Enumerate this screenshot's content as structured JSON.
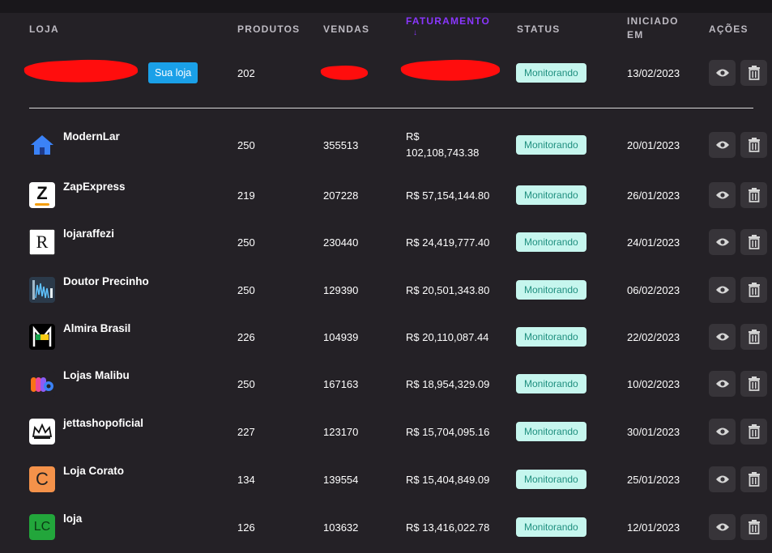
{
  "columns": {
    "loja": "LOJA",
    "produtos": "PRODUTOS",
    "vendas": "VENDAS",
    "faturamento": "FATURAMENTO",
    "sort_arrow": "↓",
    "status": "STATUS",
    "iniciado_l1": "INICIADO",
    "iniciado_l2": "EM",
    "acoes": "AÇÕES"
  },
  "own_store": {
    "badge": "Sua loja",
    "produtos": "202",
    "status": "Monitorando",
    "iniciado": "13/02/2023"
  },
  "stores": [
    {
      "name": "ModernLar",
      "produtos": "250",
      "vendas": "355513",
      "fat_l1": "R$",
      "fat_l2": "102,108,743.38",
      "status": "Monitorando",
      "iniciado": "20/01/2023",
      "logo": "house-logo"
    },
    {
      "name": "ZapExpress",
      "produtos": "219",
      "vendas": "207228",
      "fat_l1": "R$ 57,154,144.80",
      "fat_l2": "",
      "status": "Monitorando",
      "iniciado": "26/01/2023",
      "logo": "z-logo"
    },
    {
      "name": "lojaraffezi",
      "produtos": "250",
      "vendas": "230440",
      "fat_l1": "R$ 24,419,777.40",
      "fat_l2": "",
      "status": "Monitorando",
      "iniciado": "24/01/2023",
      "logo": "r-logo"
    },
    {
      "name": "Doutor Precinho",
      "produtos": "250",
      "vendas": "129390",
      "fat_l1": "R$ 20,501,343.80",
      "fat_l2": "",
      "status": "Monitorando",
      "iniciado": "06/02/2023",
      "logo": "doutor-logo"
    },
    {
      "name": "Almira Brasil",
      "produtos": "226",
      "vendas": "104939",
      "fat_l1": "R$ 20,110,087.44",
      "fat_l2": "",
      "status": "Monitorando",
      "iniciado": "22/02/2023",
      "logo": "m-logo"
    },
    {
      "name": "Lojas Malibu",
      "produtos": "250",
      "vendas": "167163",
      "fat_l1": "R$ 18,954,329.09",
      "fat_l2": "",
      "status": "Monitorando",
      "iniciado": "10/02/2023",
      "logo": "malibu-logo"
    },
    {
      "name": "jettashopoficial",
      "produtos": "227",
      "vendas": "123170",
      "fat_l1": "R$ 15,704,095.16",
      "fat_l2": "",
      "status": "Monitorando",
      "iniciado": "30/01/2023",
      "logo": "crown-logo"
    },
    {
      "name": "Loja Corato",
      "produtos": "134",
      "vendas": "139554",
      "fat_l1": "R$ 15,404,849.09",
      "fat_l2": "",
      "status": "Monitorando",
      "iniciado": "25/01/2023",
      "logo": "c-logo"
    },
    {
      "name": "loja",
      "produtos": "126",
      "vendas": "103632",
      "fat_l1": "R$ 13,416,022.78",
      "fat_l2": "",
      "status": "Monitorando",
      "iniciado": "12/01/2023",
      "logo": "lc-logo"
    }
  ],
  "logo_text": {
    "z": "Z",
    "r": "R",
    "c": "C",
    "lc": "LC"
  },
  "colors": {
    "accent": "#8a36ff",
    "status_bg": "#c6f6ee",
    "status_text": "#1f8f7f",
    "your_store": "#1aa0e8"
  }
}
